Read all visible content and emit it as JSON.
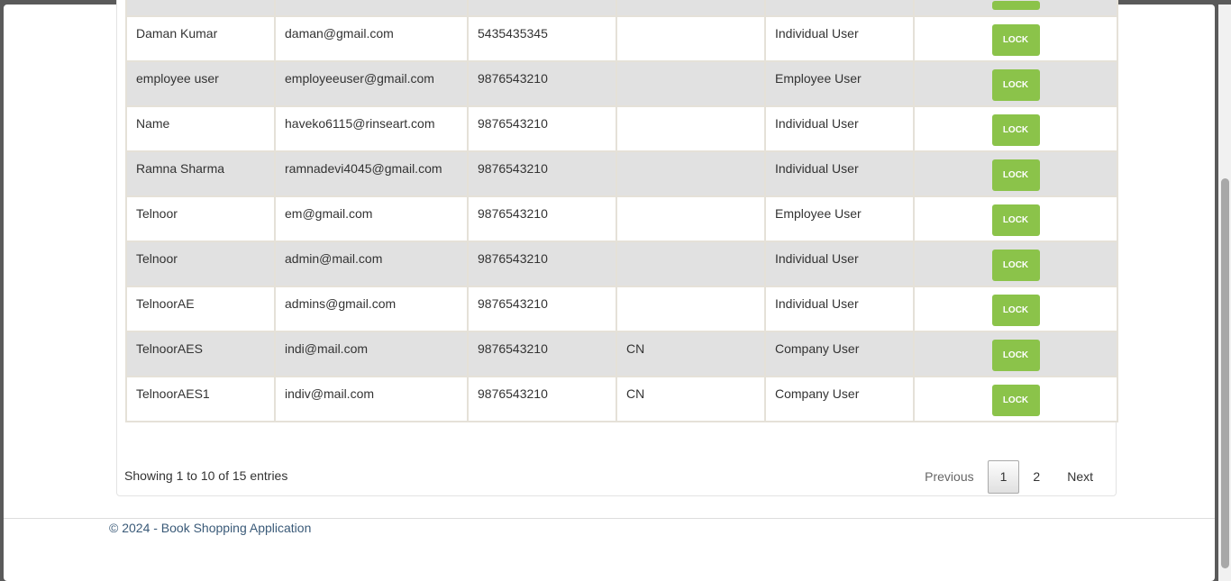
{
  "table": {
    "rows": [
      {
        "name": "",
        "email": "",
        "phone": "",
        "extra": "",
        "user_type": "",
        "action": "LOCK"
      },
      {
        "name": "Daman Kumar",
        "email": "daman@gmail.com",
        "phone": "5435435345",
        "extra": "",
        "user_type": "Individual User",
        "action": "LOCK"
      },
      {
        "name": "employee user",
        "email": "employeeuser@gmail.com",
        "phone": "9876543210",
        "extra": "",
        "user_type": "Employee User",
        "action": "LOCK"
      },
      {
        "name": "Name",
        "email": "haveko6115@rinseart.com",
        "phone": "9876543210",
        "extra": "",
        "user_type": "Individual User",
        "action": "LOCK"
      },
      {
        "name": "Ramna Sharma",
        "email": "ramnadevi4045@gmail.com",
        "phone": "9876543210",
        "extra": "",
        "user_type": "Individual User",
        "action": "LOCK"
      },
      {
        "name": "Telnoor",
        "email": "em@gmail.com",
        "phone": "9876543210",
        "extra": "",
        "user_type": "Employee User",
        "action": "LOCK"
      },
      {
        "name": "Telnoor",
        "email": "admin@mail.com",
        "phone": "9876543210",
        "extra": "",
        "user_type": "Individual User",
        "action": "LOCK"
      },
      {
        "name": "TelnoorAE",
        "email": "admins@gmail.com",
        "phone": "9876543210",
        "extra": "",
        "user_type": "Individual User",
        "action": "LOCK"
      },
      {
        "name": "TelnoorAES",
        "email": "indi@mail.com",
        "phone": "9876543210",
        "extra": "CN",
        "user_type": "Company User",
        "action": "LOCK"
      },
      {
        "name": "TelnoorAES1",
        "email": "indiv@mail.com",
        "phone": "9876543210",
        "extra": "CN",
        "user_type": "Company User",
        "action": "LOCK"
      }
    ]
  },
  "info": "Showing 1 to 10 of 15 entries",
  "pagination": {
    "previous": "Previous",
    "pages": [
      "1",
      "2"
    ],
    "current": "1",
    "next": "Next"
  },
  "footer": "© 2024 - Book Shopping Application",
  "colors": {
    "lock_button": "#8bc34a",
    "row_stripe": "#e1e1e1",
    "footer_link": "#3a5a78"
  }
}
